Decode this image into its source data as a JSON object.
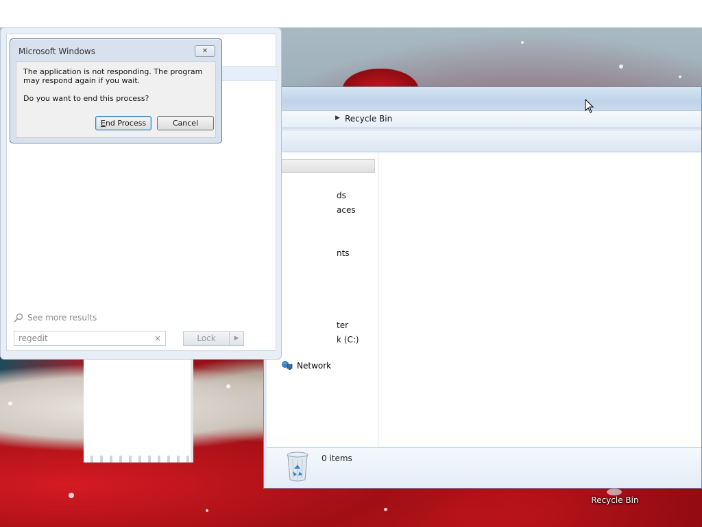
{
  "dialog": {
    "title": "Microsoft Windows",
    "message_line1": "The application is not responding. The program may respond again if you wait.",
    "message_line2": "Do you want to end this process?",
    "end_process_label_first": "E",
    "end_process_label_rest": "nd Process",
    "cancel_label": "Cancel",
    "close_glyph": "✕"
  },
  "start_menu": {
    "see_more": "See more results",
    "search_value": "regedit",
    "search_clear": "×",
    "lock_label": "Lock",
    "lock_arrow": "▶"
  },
  "explorer": {
    "address_chevron": "▶",
    "address_text": "Recycle Bin",
    "nav_items": [
      "ds",
      "aces",
      "nts",
      "ter",
      "k (C:)"
    ],
    "network_label": "Network",
    "status_items": "0 items"
  },
  "desktop": {
    "recycle_bin_label": "Recycle Bin"
  },
  "icons": {
    "search": "search-icon",
    "network": "network-icon",
    "recycle_bin": "recycle-bin-icon",
    "cursor": "mouse-cursor-icon"
  },
  "colors": {
    "dialog_frame": "#d7e2ee",
    "default_button_border": "#3c7fb1",
    "explorer_frame": "#dfe9f5"
  }
}
